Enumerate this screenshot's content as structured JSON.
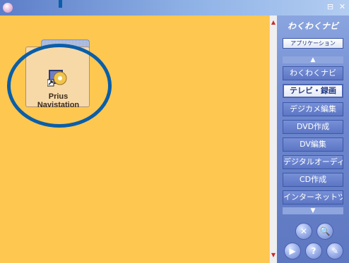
{
  "window": {
    "title": "",
    "controls": {
      "minimize": "⊟",
      "close": "✕"
    }
  },
  "desktop": {
    "folder_label_line1": "Prius",
    "folder_label_line2": "Navistation"
  },
  "sidebar": {
    "brand": "わくわくナビ",
    "app_button": "アプリケーション",
    "menu": [
      "わくわくナビ",
      "テレビ・録画",
      "デジカメ編集",
      "DVD作成",
      "DV編集",
      "デジタルオーディオ",
      "CD作成",
      "インターネットツール"
    ],
    "active_index": 1,
    "buttons": {
      "close": "✕",
      "search": "🔍",
      "play": "▶",
      "help": "?",
      "edit": "✎"
    }
  },
  "colors": {
    "main_bg": "#fec74f",
    "sidebar_bg": "#6f88cf",
    "highlight": "#0b5ea8"
  }
}
